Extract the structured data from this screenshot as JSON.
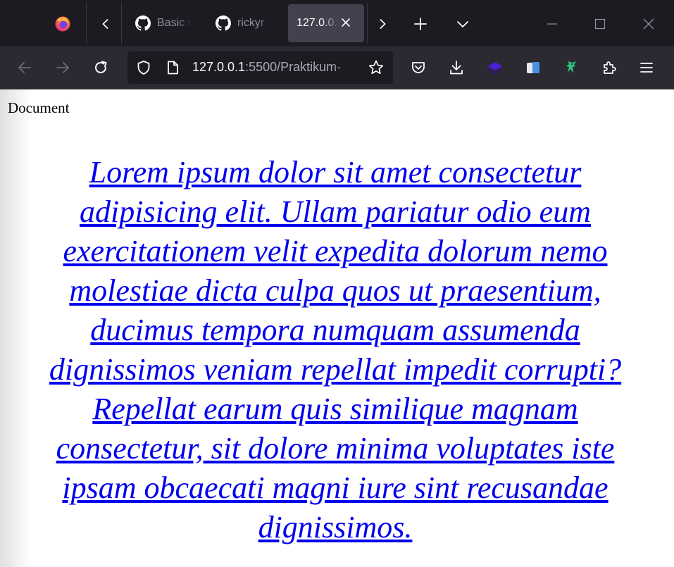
{
  "tabs": [
    {
      "label": "Basic v",
      "icon": "github-icon",
      "active": false
    },
    {
      "label": "rickyr",
      "icon": "github-icon",
      "active": false
    },
    {
      "label": "127.0.0.",
      "icon": "",
      "active": true
    }
  ],
  "urlbar": {
    "host": "127.0.0.1",
    "path": ":5500/Praktikum-"
  },
  "page": {
    "document_label": "Document",
    "link_text": "Lorem ipsum dolor sit amet consectetur adipisicing elit. Ullam pariatur odio eum exercitationem velit expedita dolorum nemo molestiae dicta culpa quos ut praesentium, ducimus tempora numquam assumenda dignissimos veniam repellat impedit corrupti? Repellat earum quis similique magnam consectetur, sit dolore minima voluptates iste ipsam obcaecati magni iure sint recusandae dignissimos."
  },
  "colors": {
    "tabstrip_bg": "#1c1b22",
    "toolbar_bg": "#2b2a33",
    "link": "#0000ee",
    "extension_accent": "#2ec27e"
  }
}
